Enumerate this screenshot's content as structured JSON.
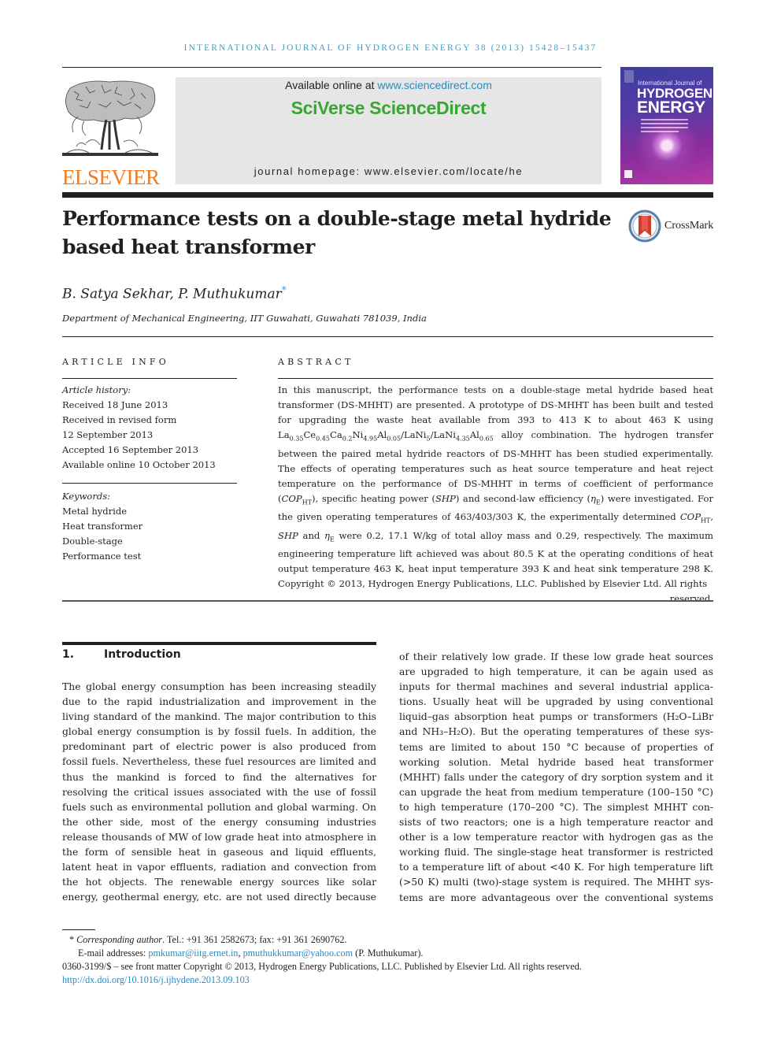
{
  "running_head": "INTERNATIONAL JOURNAL OF HYDROGEN ENERGY 38 (2013) 15428–15437",
  "masthead": {
    "publisher_logo": "ELSEVIER",
    "available_online_prefix": "Available online at ",
    "available_online_link": "www.sciencedirect.com",
    "brand": "SciVerse ScienceDirect",
    "homepage": "journal homepage: www.elsevier.com/locate/he",
    "cover": {
      "small_text": "International Journal of",
      "title_line1": "HYDROGEN",
      "title_line2": "ENERGY"
    },
    "colors": {
      "running_head": "#3b9fc4",
      "elsevier": "#f47b20",
      "brand_green": "#3aa534",
      "link": "#2a8ac2"
    }
  },
  "article": {
    "title": "Performance tests on a double-stage metal hydride based heat transformer",
    "crossmark_label": "CrossMark",
    "authors": "B. Satya Sekhar, P. Muthukumar",
    "author_mark": "*",
    "affiliation": "Department of Mechanical Engineering, IIT Guwahati, Guwahati 781039, India"
  },
  "article_info": {
    "heading": "ARTICLE INFO",
    "history_label": "Article history:",
    "history": [
      "Received 18 June 2013",
      "Received in revised form",
      "12 September 2013",
      "Accepted 16 September 2013",
      "Available online 10 October 2013"
    ],
    "keywords_label": "Keywords:",
    "keywords": [
      "Metal hydride",
      "Heat transformer",
      "Double-stage",
      "Performance test"
    ]
  },
  "abstract": {
    "heading": "ABSTRACT",
    "p1": "In this manuscript, the performance tests on a double-stage metal hydride based heat transformer (DS-MHHT) are presented. A prototype of DS-MHHT has been built and tested for upgrading the waste heat available from 393 to 413 K to about 463 K using ",
    "alloy": {
      "parts": [
        [
          "La",
          "0.35"
        ],
        [
          "Ce",
          "0.45"
        ],
        [
          "Ca",
          "0.2"
        ],
        [
          "Ni",
          "4.95"
        ],
        [
          "Al",
          "0.05"
        ],
        [
          "/LaNi",
          "5"
        ],
        [
          "/LaNi",
          "4.35"
        ],
        [
          "Al",
          "0.65"
        ]
      ]
    },
    "p2": " alloy combination. The hydrogen transfer between the paired metal hydride reactors of DS-MHHT has been studied experimentally. The effects of operating temperatures such as heat source temperature and heat reject temperature on the performance of DS-MHHT in terms of coefficient of performance (",
    "cop": "COP",
    "cop_sub": "HT",
    "p3": "), specific heating power (",
    "shp": "SHP",
    "p4": ") and second-law efficiency (",
    "eta": "η",
    "eta_sub": "E",
    "p5": ") were investigated. For the given operating temperatures of 463/403/303 K, the experimentally determined ",
    "p6": ", ",
    "p7": " and ",
    "p8": " were 0.2, 17.1 W/kg of total alloy mass and 0.29, respectively. The maximum engineering temperature lift achieved was about 80.5 K at the operating conditions of heat output temperature 463 K, heat input temperature 393 K and heat sink temperature 298 K. Copyright © 2013, Hydrogen Energy Publications, LLC. Published by Elsevier Ltd. All rights",
    "last": "reserved."
  },
  "introduction": {
    "number": "1.",
    "heading": "Introduction",
    "col1_lines": [
      "The global energy consumption has been increasing steadily",
      "due to the rapid industrialization and improvement in the",
      "living standard of the mankind. The major contribution to this",
      "global energy consumption is by fossil fuels. In addition, the",
      "predominant part of electric power is also produced from",
      "fossil fuels. Nevertheless, these fuel resources are limited and",
      "thus the mankind is forced to find the alternatives for",
      "resolving the critical issues associated with the use of fossil",
      "fuels such as environmental pollution and global warming. On",
      "the other side, most of the energy consuming industries",
      "release thousands of MW of low grade heat into atmosphere in",
      "the form of sensible heat in gaseous and liquid effluents,",
      "latent heat in vapor effluents, radiation and convection from",
      "the hot objects. The renewable energy sources like solar",
      "energy, geothermal energy, etc. are not used directly because"
    ],
    "col2_lines": [
      "of their relatively low grade. If these low grade heat sources",
      "are upgraded to high temperature, it can be again used as",
      "inputs for thermal machines and several industrial applica-",
      "tions. Usually heat will be upgraded by using conventional",
      "liquid–gas absorption heat pumps or transformers (H₂O–LiBr",
      "and NH₃–H₂O). But the operating temperatures of these sys-",
      "tems are limited to about 150 °C because of properties of",
      "working solution. Metal hydride based heat transformer",
      "(MHHT) falls under the category of dry sorption system and it",
      "can upgrade the heat from medium temperature (100–150 °C)",
      "to high temperature (170–200 °C). The simplest MHHT con-",
      "sists of two reactors; one is a high temperature reactor and",
      "other is a low temperature reactor with hydrogen gas as the",
      "working fluid. The single-stage heat transformer is restricted",
      "to a temperature lift of about <40 K. For high temperature lift",
      "(>50 K) multi (two)-stage system is required. The MHHT sys-",
      "tems are more advantageous over the conventional systems"
    ]
  },
  "footnotes": {
    "corr_mark": "*",
    "corr_label": "Corresponding author",
    "corr_text": ". Tel.: +91 361 2582673; fax: +91 361 2690762.",
    "email_label": "E-mail addresses: ",
    "email1": "pmkumar@iitg.ernet.in",
    "email_sep": ", ",
    "email2": "pmuthukkumar@yahoo.com",
    "email_owner": " (P. Muthukumar).",
    "copyright": "0360-3199/$ – see front matter Copyright © 2013, Hydrogen Energy Publications, LLC. Published by Elsevier Ltd. All rights reserved.",
    "doi": "http://dx.doi.org/10.1016/j.ijhydene.2013.09.103"
  }
}
